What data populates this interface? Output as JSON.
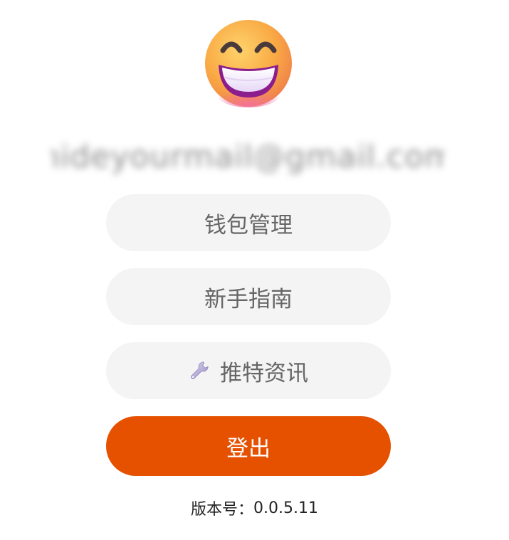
{
  "profile": {
    "email": "hideyourmail@gmail.com"
  },
  "menu": {
    "wallet_label": "钱包管理",
    "guide_label": "新手指南",
    "news_label": "推特资讯",
    "news_icon": "wrench-icon",
    "logout_label": "登出"
  },
  "footer": {
    "version_label": "版本号：",
    "version_value": "0.0.5.11"
  },
  "colors": {
    "pill_bg": "#f4f4f4",
    "logout_bg": "#e65100",
    "pill_text": "#666666"
  }
}
